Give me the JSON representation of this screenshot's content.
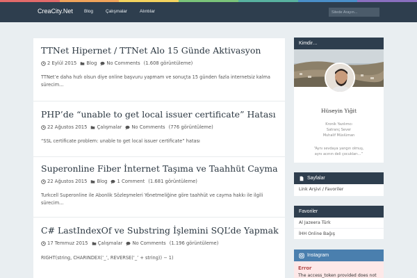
{
  "colors": {
    "nav_bg": "#2e3e4e",
    "accent_blue": "#4a7fae",
    "page_bg": "#e9eef1",
    "stripe": [
      "#e26a6a",
      "#f0a35a",
      "#f4d35e",
      "#7ac47a",
      "#58b2a0",
      "#4a8fc9",
      "#8a6fbf"
    ]
  },
  "navbar": {
    "brand": "CreaCity.Net",
    "links": [
      "Blog",
      "Çalışmalar",
      "Alıntılar"
    ],
    "search_placeholder": "Sitede Arayın..."
  },
  "posts": [
    {
      "title": "TTNet Hipernet / TTNet Alo 15 Günde Aktivasyon",
      "date": "2 Eylül 2015",
      "category": "Blog",
      "comments": "No Comments",
      "views": "(1.608 görüntüleme)",
      "excerpt": "TTNet’e daha hızlı olsun diye online başvuru yapmam ve sonuçta 15 günden fazla internetsiz kalma sürecim…"
    },
    {
      "title": "PHP’de “unable to get local issuer certificate” Hatası",
      "date": "22 Ağustos 2015",
      "category": "Çalışmalar",
      "comments": "No Comments",
      "views": "(776 görüntüleme)",
      "excerpt": "“SSL certificate problem: unable to get local issuer certificate” hatası"
    },
    {
      "title": "Superonline Fiber İnternet Taşıma ve Taahhüt Cayma",
      "date": "22 Ağustos 2015",
      "category": "Blog",
      "comments": "1 Comment",
      "views": "(1.681 görüntüleme)",
      "excerpt": "Turkcell Superonline ile Abonlik Sözleşmeleri Yönetmeliğine göre taahhüt ve cayma hakkı ile ilgili sürecim…"
    },
    {
      "title": "C# LastIndexOf ve Substring İşlemini SQL’de Yapmak",
      "date": "17 Temmuz 2015",
      "category": "Çalışmalar",
      "comments": "No Comments",
      "views": "(1.196 görüntüleme)",
      "excerpt": "RIGHT(string, CHARINDEX(‘_’, REVERSE(‘_’ + string)) − 1)"
    }
  ],
  "sidebar": {
    "about": {
      "title": "Kimdir…",
      "name": "Hüseyin Yiğit",
      "lines": [
        "Kronik Yazılımcı",
        "Satranç Sever",
        "Muhalif Müslüman"
      ],
      "quote": [
        "“Aynı sevdaya yangın olmuş,",
        "aynı acının deli çocukları…”"
      ]
    },
    "pages": {
      "title": "Sayfalar",
      "items": [
        "Link Arşivi / Favoriler"
      ]
    },
    "favorites": {
      "title": "Favoriler",
      "items": [
        "Al Jazeera Türk",
        "İHH Online Bağış"
      ]
    },
    "instagram": {
      "title": "Instagram",
      "error_title": "Error",
      "error_text": "The access_token provided does not"
    }
  }
}
